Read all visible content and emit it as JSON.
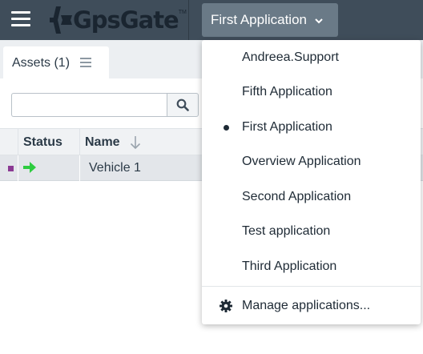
{
  "topbar": {
    "logo_text": "GpsGate",
    "logo_tm": "TM",
    "current_app": "First Application"
  },
  "assets_tab": {
    "label": "Assets (1)"
  },
  "search": {
    "value": "",
    "placeholder": ""
  },
  "table": {
    "columns": [
      "Status",
      "Name"
    ],
    "sort_icon": "arrow-down-icon",
    "rows": [
      {
        "marker_color": "#8b3a93",
        "status_icon": "arrow-right-icon",
        "status_color": "#2ecc40",
        "name": "Vehicle 1"
      }
    ]
  },
  "app_menu": {
    "items": [
      {
        "label": "Andreea.Support",
        "selected": false
      },
      {
        "label": "Fifth Application",
        "selected": false
      },
      {
        "label": "First Application",
        "selected": true
      },
      {
        "label": "Overview Application",
        "selected": false
      },
      {
        "label": "Second Application",
        "selected": false
      },
      {
        "label": "Test application",
        "selected": false
      },
      {
        "label": "Third Application",
        "selected": false
      }
    ],
    "manage_label": "Manage applications...",
    "manage_icon": "gear-icon"
  },
  "colors": {
    "topbar_bg": "#3f4d5a",
    "app_select_bg": "#6a7a87",
    "logo_accent": "#1a2530"
  }
}
